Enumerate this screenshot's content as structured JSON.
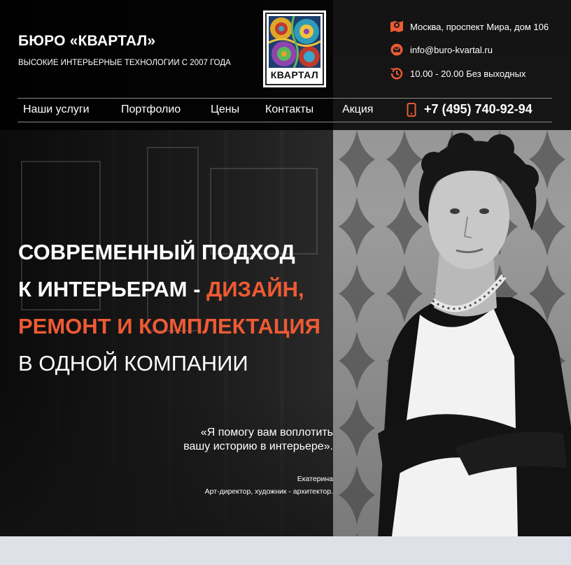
{
  "brand": {
    "name": "БЮРО «КВАРТАЛ»",
    "tagline": "ВЫСОКИЕ ИНТЕРЬЕРНЫЕ ТЕХНОЛОГИИ С 2007 ГОДА",
    "logo_text": "КВАРТАЛ"
  },
  "contacts": {
    "address": "Москва, проспект Мира, дом 106",
    "email": "info@buro-kvartal.ru",
    "hours": "10.00 - 20.00 Без выходных"
  },
  "nav": {
    "items": [
      {
        "label": "Наши услуги"
      },
      {
        "label": "Портфолио"
      },
      {
        "label": "Цены"
      },
      {
        "label": "Контакты"
      },
      {
        "label": "Акция"
      }
    ],
    "phone": "+7 (495) 740-92-94"
  },
  "hero": {
    "line1": "СОВРЕМЕННЫЙ ПОДХОД",
    "line2_prefix": "К ИНТЕРЬЕРАМ - ",
    "line2_accent": "ДИЗАЙН,",
    "line3": "РЕМОНТ И КОМПЛЕКТАЦИЯ",
    "line4": "В ОДНОЙ КОМПАНИИ",
    "quote_line1": "«Я помогу вам воплотить",
    "quote_line2": "вашу историю в интерьере».",
    "author_name": "Екатерина",
    "author_role": "Арт-директор, художник - архитектор."
  },
  "colors": {
    "accent": "#ee5a34",
    "header_bg": "#000000",
    "text": "#ffffff",
    "footer_strip": "#dfe1e8"
  },
  "icons": {
    "address": "map-pin-icon",
    "email": "email-icon",
    "hours": "clock-icon",
    "phone": "mobile-phone-icon"
  }
}
